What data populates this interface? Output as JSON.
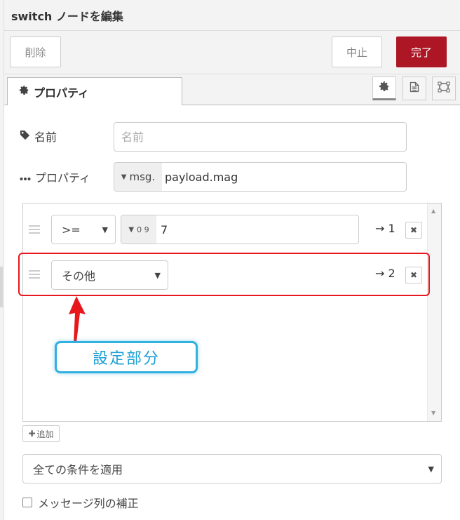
{
  "header": {
    "title": "switch ノードを編集"
  },
  "toolbar": {
    "delete_label": "削除",
    "cancel_label": "中止",
    "done_label": "完了"
  },
  "tabs": {
    "properties_label": "プロパティ"
  },
  "form": {
    "name_label": "名前",
    "name_placeholder": "名前",
    "property_label": "プロパティ",
    "property_type": "msg.",
    "property_value": "payload.mag"
  },
  "rules": [
    {
      "operator": ">=",
      "value_type_icon": "0 9",
      "value": "7",
      "output": "→ 1"
    },
    {
      "operator": "その他",
      "output": "→ 2"
    }
  ],
  "annotation": {
    "callout_text": "設定部分"
  },
  "add_label": "追加",
  "check_mode": "全ての条件を適用",
  "recreate_sequence_label": "メッセージ列の補正",
  "colors": {
    "done_button": "#ad1625",
    "highlight": "#e8161d",
    "callout": "#32b0e0"
  }
}
